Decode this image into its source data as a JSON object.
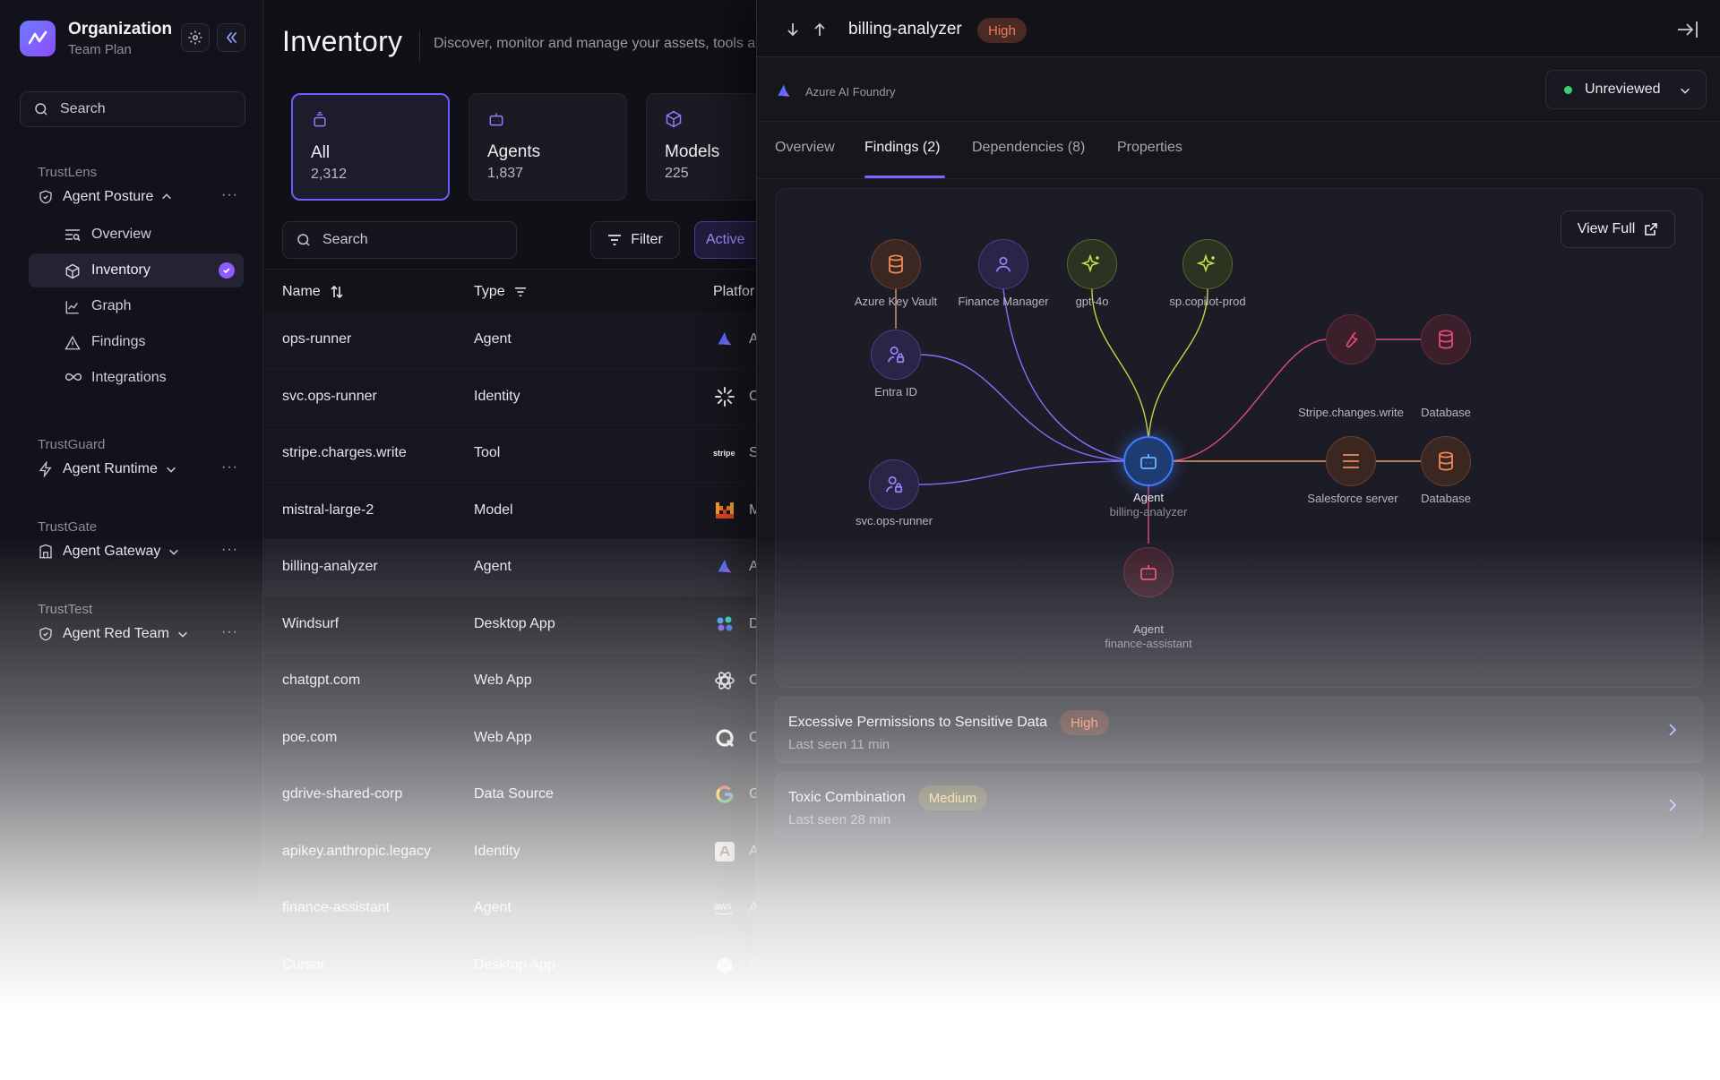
{
  "org": {
    "name": "Organization",
    "plan": "Team Plan"
  },
  "sidebar": {
    "search_label": "Search",
    "groups": [
      {
        "title": "TrustLens",
        "label": "Agent Posture"
      },
      {
        "title": "TrustGuard",
        "label": "Agent Runtime"
      },
      {
        "title": "TrustGate",
        "label": "Agent Gateway"
      },
      {
        "title": "TrustTest",
        "label": "Agent Red Team"
      }
    ],
    "items": [
      {
        "label": "Overview"
      },
      {
        "label": "Inventory"
      },
      {
        "label": "Graph"
      },
      {
        "label": "Findings"
      },
      {
        "label": "Integrations"
      }
    ],
    "more": "···"
  },
  "inventory": {
    "title": "Inventory",
    "description": "Discover, monitor and manage your assets, tools a",
    "categories": [
      {
        "label": "All",
        "count": "2,312"
      },
      {
        "label": "Agents",
        "count": "1,837"
      },
      {
        "label": "Models",
        "count": "225"
      }
    ],
    "search_label": "Search",
    "filter_label": "Filter",
    "active_label": "Active",
    "columns": {
      "name": "Name",
      "type": "Type",
      "platform": "Platfor"
    },
    "rows": [
      {
        "name": "ops-runner",
        "type": "Agent",
        "platform": "A",
        "icon": "azure-foundry-icon"
      },
      {
        "name": "svc.ops-runner",
        "type": "Identity",
        "platform": "C",
        "icon": "sunburst-icon"
      },
      {
        "name": "stripe.charges.write",
        "type": "Tool",
        "platform": "S",
        "icon": "stripe-icon"
      },
      {
        "name": "mistral-large-2",
        "type": "Model",
        "platform": "M",
        "icon": "mistral-icon"
      },
      {
        "name": "billing-analyzer",
        "type": "Agent",
        "platform": "A",
        "icon": "azure-foundry-icon"
      },
      {
        "name": "Windsurf",
        "type": "Desktop App",
        "platform": "D",
        "icon": "windsurf-icon"
      },
      {
        "name": "chatgpt.com",
        "type": "Web App",
        "platform": "C",
        "icon": "openai-icon"
      },
      {
        "name": "poe.com",
        "type": "Web App",
        "platform": "C",
        "icon": "poe-icon"
      },
      {
        "name": "gdrive-shared-corp",
        "type": "Data Source",
        "platform": "G",
        "icon": "google-icon"
      },
      {
        "name": "apikey.anthropic.legacy",
        "type": "Identity",
        "platform": "A",
        "icon": "anthropic-icon"
      },
      {
        "name": "finance-assistant",
        "type": "Agent",
        "platform": "A",
        "icon": "aws-icon"
      },
      {
        "name": "Cursor",
        "type": "Desktop App",
        "platform": "C",
        "icon": "cursor-icon"
      }
    ]
  },
  "detail": {
    "title": "billing-analyzer",
    "severity": "High",
    "source": "Azure AI Foundry",
    "status": "Unreviewed",
    "tabs": [
      {
        "label": "Overview"
      },
      {
        "label": "Findings (2)"
      },
      {
        "label": "Dependencies (8)"
      },
      {
        "label": "Properties"
      }
    ],
    "view_full": "View Full",
    "graph": {
      "nodes": [
        {
          "label": "Azure Key Vault"
        },
        {
          "label": "Finance Manager"
        },
        {
          "label": "gpt-4o"
        },
        {
          "label": "sp.copilot-prod"
        },
        {
          "label": "Entra ID"
        },
        {
          "label": "svc.ops-runner"
        },
        {
          "label": "Agent",
          "sub": "billing-analyzer"
        },
        {
          "label": "Agent",
          "sub": "finance-assistant"
        },
        {
          "label": "Stripe.changes.write"
        },
        {
          "label": "Database"
        },
        {
          "label": "Salesforce server"
        },
        {
          "label": "Database"
        }
      ]
    },
    "findings": [
      {
        "title": "Excessive Permissions to Sensitive Data",
        "severity": "High",
        "seen": "Last seen 11 min"
      },
      {
        "title": "Toxic Combination",
        "severity": "Medium",
        "seen": "Last seen 28 min"
      }
    ]
  }
}
